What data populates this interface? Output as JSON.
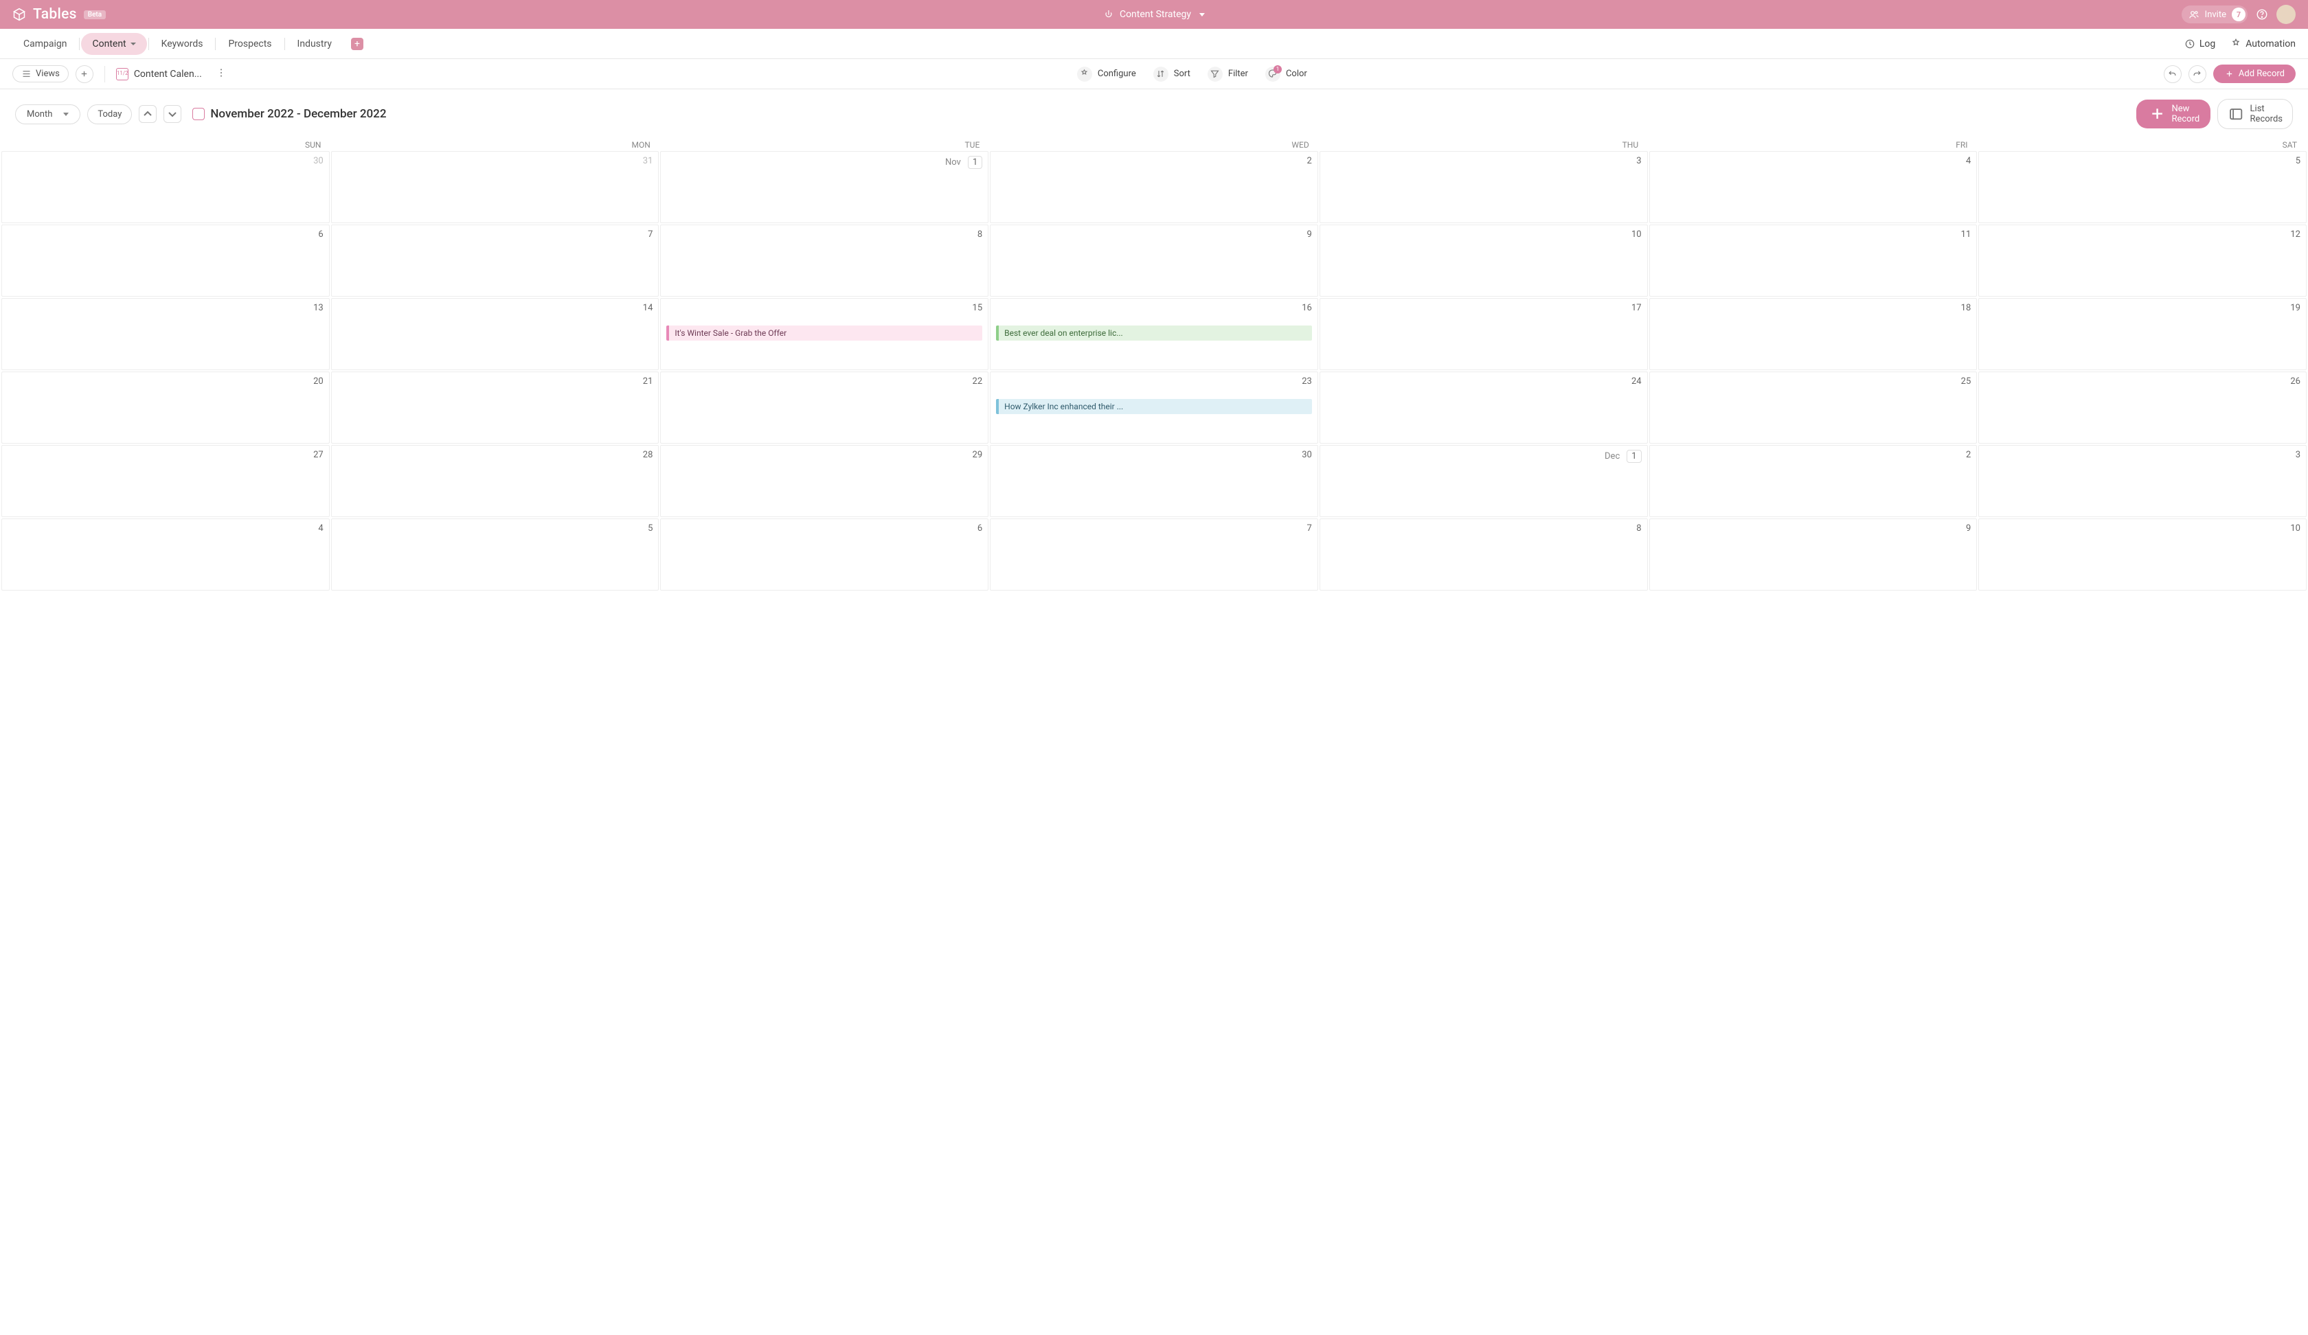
{
  "topbar": {
    "product_name": "Tables",
    "beta_label": "Beta",
    "workspace_name": "Content Strategy",
    "invite_label": "Invite",
    "invite_count": "7"
  },
  "tabs": {
    "items": [
      "Campaign",
      "Content",
      "Keywords",
      "Prospects",
      "Industry"
    ],
    "active_index": 1,
    "log_label": "Log",
    "automation_label": "Automation"
  },
  "toolbar": {
    "views_label": "Views",
    "view_name": "Content Calen...",
    "configure_label": "Configure",
    "sort_label": "Sort",
    "filter_label": "Filter",
    "color_label": "Color",
    "color_badge": "1",
    "add_record_label": "Add Record"
  },
  "cal_header": {
    "scale_label": "Month",
    "today_label": "Today",
    "title": "November 2022 - December 2022",
    "new_record_label": "New Record",
    "list_records_label": "List Records"
  },
  "day_names": [
    "SUN",
    "MON",
    "TUE",
    "WED",
    "THU",
    "FRI",
    "SAT"
  ],
  "weeks": [
    [
      {
        "num": "30",
        "other": true
      },
      {
        "num": "31",
        "other": true
      },
      {
        "prefix": "Nov",
        "num": "1",
        "boxed": true
      },
      {
        "num": "2"
      },
      {
        "num": "3"
      },
      {
        "num": "4"
      },
      {
        "num": "5"
      }
    ],
    [
      {
        "num": "6"
      },
      {
        "num": "7"
      },
      {
        "num": "8"
      },
      {
        "num": "9"
      },
      {
        "num": "10"
      },
      {
        "num": "11"
      },
      {
        "num": "12"
      }
    ],
    [
      {
        "num": "13"
      },
      {
        "num": "14"
      },
      {
        "num": "15",
        "event": {
          "text": "It's Winter Sale - Grab the Offer",
          "cls": "ev-pink"
        }
      },
      {
        "num": "16",
        "event": {
          "text": "Best ever deal on enterprise lic...",
          "cls": "ev-green"
        }
      },
      {
        "num": "17"
      },
      {
        "num": "18"
      },
      {
        "num": "19"
      }
    ],
    [
      {
        "num": "20"
      },
      {
        "num": "21"
      },
      {
        "num": "22"
      },
      {
        "num": "23",
        "event": {
          "text": "How Zylker Inc enhanced their ...",
          "cls": "ev-blue"
        }
      },
      {
        "num": "24"
      },
      {
        "num": "25"
      },
      {
        "num": "26"
      }
    ],
    [
      {
        "num": "27"
      },
      {
        "num": "28"
      },
      {
        "num": "29"
      },
      {
        "num": "30"
      },
      {
        "prefix": "Dec",
        "num": "1",
        "boxed": true
      },
      {
        "num": "2"
      },
      {
        "num": "3"
      }
    ],
    [
      {
        "num": "4"
      },
      {
        "num": "5"
      },
      {
        "num": "6"
      },
      {
        "num": "7"
      },
      {
        "num": "8"
      },
      {
        "num": "9"
      },
      {
        "num": "10"
      }
    ]
  ]
}
